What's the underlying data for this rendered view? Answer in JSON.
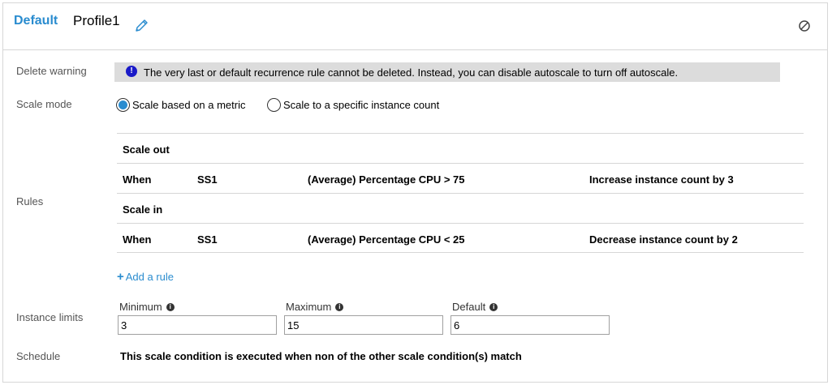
{
  "header": {
    "default_label": "Default",
    "profile_name": "Profile1"
  },
  "labels": {
    "delete_warning": "Delete warning",
    "scale_mode": "Scale mode",
    "rules": "Rules",
    "instance_limits": "Instance limits",
    "schedule": "Schedule"
  },
  "warning": {
    "text": "The very last or default recurrence rule cannot be deleted. Instead, you can disable autoscale to turn off autoscale."
  },
  "scale_mode": {
    "options": [
      {
        "label": "Scale based on a metric",
        "selected": true
      },
      {
        "label": "Scale to a specific instance count",
        "selected": false
      }
    ]
  },
  "rules": {
    "scale_out_heading": "Scale out",
    "scale_in_heading": "Scale in",
    "scale_out": {
      "when": "When",
      "resource": "SS1",
      "condition": "(Average) Percentage CPU > 75",
      "action": "Increase instance count by 3"
    },
    "scale_in": {
      "when": "When",
      "resource": "SS1",
      "condition": "(Average) Percentage CPU < 25",
      "action": "Decrease instance count by 2"
    },
    "add_rule": "Add a rule"
  },
  "limits": {
    "minimum_label": "Minimum",
    "minimum_value": "3",
    "maximum_label": "Maximum",
    "maximum_value": "15",
    "default_label": "Default",
    "default_value": "6"
  },
  "schedule": {
    "text": "This scale condition is executed when non of the other scale condition(s) match"
  },
  "colors": {
    "accent": "#2a8ccf",
    "info": "#1a1ac8",
    "warning_bg": "#dcdcdc"
  }
}
